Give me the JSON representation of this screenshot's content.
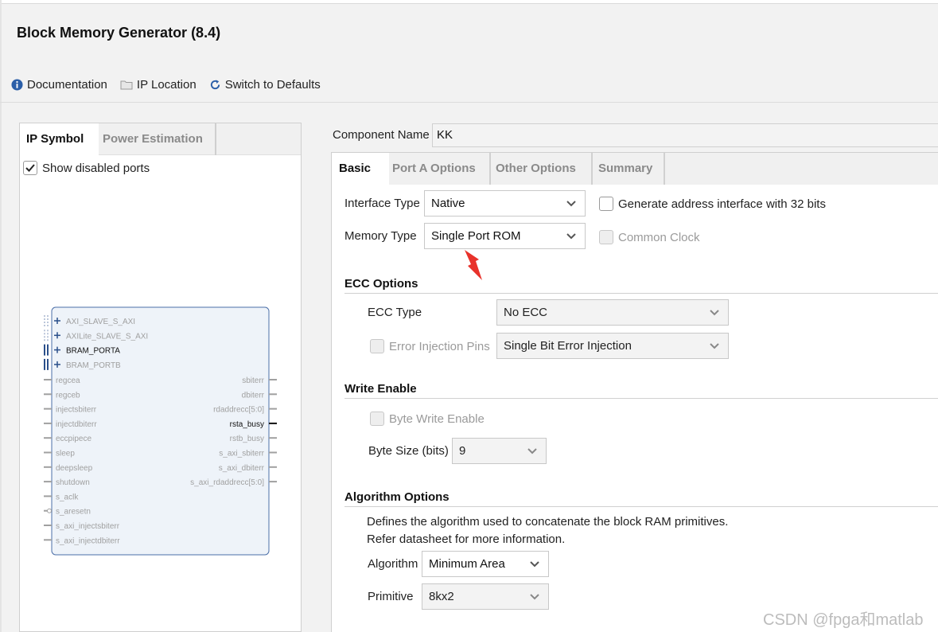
{
  "window": {
    "title": "Block Memory Generator (8.4)"
  },
  "toolbar": {
    "documentation": "Documentation",
    "ip_location": "IP Location",
    "switch_defaults": "Switch to Defaults"
  },
  "left_panel": {
    "tabs": [
      "IP Symbol",
      "Power Estimation"
    ],
    "show_disabled_ports": {
      "label": "Show disabled ports",
      "checked": true
    },
    "symbol": {
      "bus_ports": [
        "AXI_SLAVE_S_AXI",
        "AXILite_SLAVE_S_AXI",
        "BRAM_PORTA",
        "BRAM_PORTB"
      ],
      "left_ports": [
        "regcea",
        "regceb",
        "injectsbiterr",
        "injectdbiterr",
        "eccpipece",
        "sleep",
        "deepsleep",
        "shutdown",
        "s_aclk",
        "s_aresetn",
        "s_axi_injectsbiterr",
        "s_axi_injectdbiterr"
      ],
      "right_ports": [
        "sbiterr",
        "dbiterr",
        "rdaddrecc[5:0]",
        "rsta_busy",
        "rstb_busy",
        "s_axi_sbiterr",
        "s_axi_dbiterr",
        "s_axi_rdaddrecc[5:0]"
      ]
    }
  },
  "component": {
    "label": "Component Name",
    "value": "KK"
  },
  "tabs": [
    "Basic",
    "Port A Options",
    "Other Options",
    "Summary"
  ],
  "basic": {
    "interface_type": {
      "label": "Interface Type",
      "value": "Native"
    },
    "memory_type": {
      "label": "Memory Type",
      "value": "Single Port ROM"
    },
    "gen_address": {
      "label": "Generate address interface with 32 bits",
      "checked": false
    },
    "common_clock": {
      "label": "Common Clock",
      "checked": false,
      "enabled": false
    }
  },
  "ecc": {
    "section": "ECC Options",
    "type_label": "ECC Type",
    "type_value": "No ECC",
    "error_injection_label": "Error Injection Pins",
    "error_injection_value": "Single Bit Error Injection"
  },
  "write_enable": {
    "section": "Write Enable",
    "byte_write_label": "Byte Write Enable",
    "byte_size_label": "Byte Size (bits)",
    "byte_size_value": "9"
  },
  "algorithm": {
    "section": "Algorithm Options",
    "desc1": "Defines the algorithm used to concatenate the block RAM primitives.",
    "desc2": "Refer datasheet for more information.",
    "algorithm_label": "Algorithm",
    "algorithm_value": "Minimum Area",
    "primitive_label": "Primitive",
    "primitive_value": "8kx2"
  },
  "watermark": "CSDN @fpga和matlab",
  "colors": {
    "accent_blue": "#2a5ea8",
    "symbol_fill": "#eef3f9",
    "symbol_border": "#4b6fa8",
    "arrow_red": "#e8322b"
  }
}
